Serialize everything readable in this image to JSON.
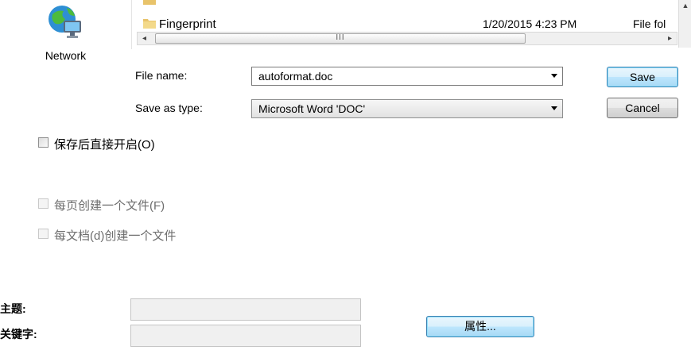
{
  "nav": {
    "network_label": "Network",
    "network_icon": "network-globe-icon"
  },
  "file_list": {
    "rows": [
      {
        "name": "Fingerprint",
        "date": "1/20/2015 4:23 PM",
        "type": "File fol",
        "icon": "folder-icon"
      }
    ],
    "hscroll_grip": "III"
  },
  "form": {
    "file_name_label": "File name:",
    "file_name_value": "autoformat.doc",
    "save_type_label": "Save as type:",
    "save_type_value": "Microsoft Word 'DOC'",
    "save_button": "Save",
    "cancel_button": "Cancel"
  },
  "options": {
    "open_after_save": "保存后直接开启(O)",
    "file_per_page": "每页创建一个文件(F)",
    "file_per_document": "每文档(d)创建一个文件"
  },
  "metadata": {
    "subject_label": "主题:",
    "keywords_label": "关键字:",
    "properties_button": "属性..."
  },
  "colors": {
    "accent_button_border": "#3c7fb1",
    "folder": "#e8c36a"
  }
}
